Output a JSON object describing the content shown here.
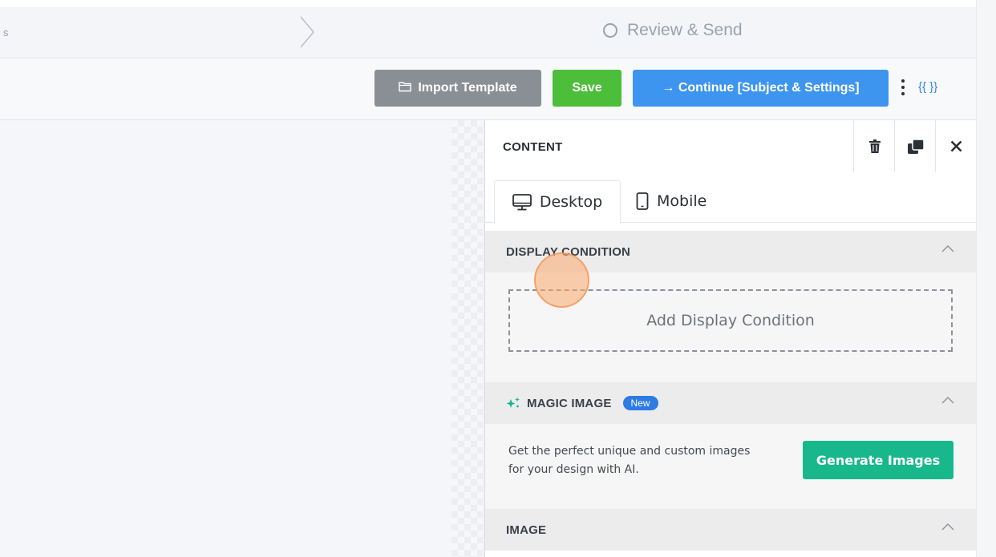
{
  "steps": {
    "prev_step_tail": "s",
    "current_step_label": "Review & Send"
  },
  "toolbar": {
    "import_label": "Import Template",
    "save_label": "Save",
    "continue_label": "→ Continue [Subject & Settings]",
    "merge_tags_label": "{{ }}"
  },
  "panel": {
    "title": "CONTENT",
    "tabs": [
      {
        "label": "Desktop",
        "icon": "desktop-icon",
        "active": true
      },
      {
        "label": "Mobile",
        "icon": "mobile-icon",
        "active": false
      }
    ],
    "display_condition": {
      "title": "DISPLAY CONDITION",
      "add_label": "Add Display Condition"
    },
    "magic_image": {
      "title": "MAGIC IMAGE",
      "badge": "New",
      "description": "Get the perfect unique and custom images for your design with AI.",
      "button_label": "Generate Images"
    },
    "image": {
      "title": "IMAGE"
    }
  },
  "colors": {
    "save": "#4cbe3a",
    "continue": "#3d95ef",
    "import": "#8a8f95",
    "generate": "#18b88c",
    "badge": "#2d7be3",
    "sparkle": "#18b88c"
  }
}
